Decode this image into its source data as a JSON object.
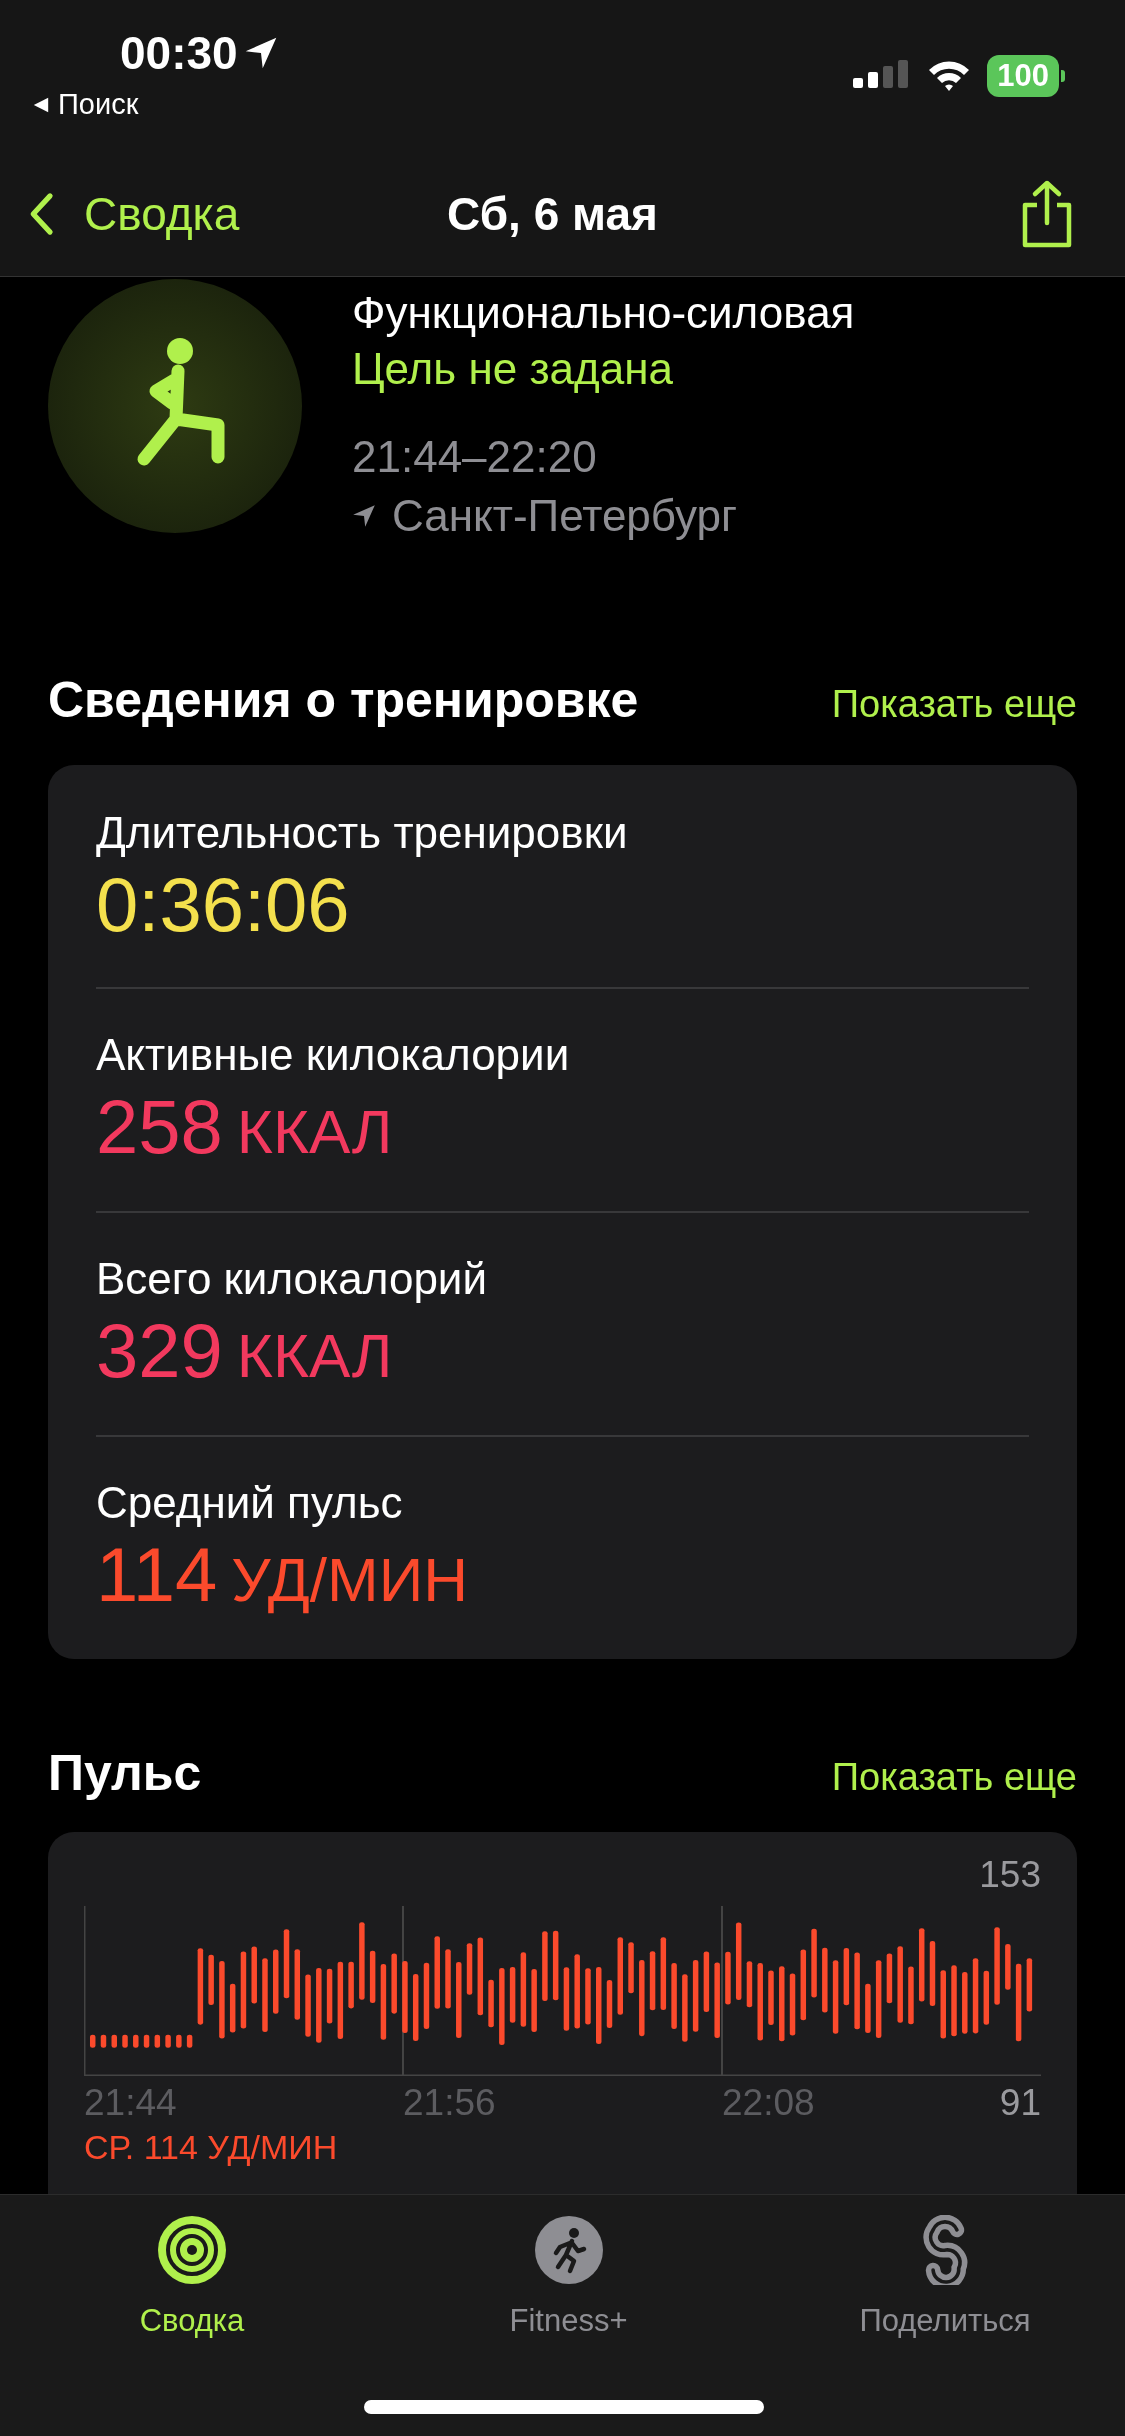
{
  "status_bar": {
    "time": "00:30",
    "back_label": "Поиск",
    "battery": "100"
  },
  "nav": {
    "back": "Сводка",
    "title": "Сб, 6 мая"
  },
  "workout": {
    "name": "Функционально-силовая",
    "goal": "Цель не задана",
    "time_range": "21:44–22:20",
    "location": "Санкт-Петербург"
  },
  "details": {
    "title": "Сведения о тренировке",
    "more": "Показать еще",
    "metrics": [
      {
        "label": "Длительность тренировки",
        "value": "0:36:06",
        "color": "#f4e04d"
      },
      {
        "label": "Активные килокалории",
        "value": "258",
        "unit": "ККАЛ",
        "color": "#f2395e"
      },
      {
        "label": "Всего килокалорий",
        "value": "329",
        "unit": "ККАЛ",
        "color": "#f2395e"
      },
      {
        "label": "Средний пульс",
        "value": "114",
        "unit": "УД/МИН",
        "color": "#fb4a2c"
      }
    ]
  },
  "heart_rate": {
    "title": "Пульс",
    "more": "Показать еще",
    "y_max": "153",
    "y_min": "91",
    "x_labels": [
      "21:44",
      "21:56",
      "22:08"
    ],
    "average": "СР. 114 УД/МИН"
  },
  "tab_bar": [
    {
      "label": "Сводка",
      "selected": true,
      "kind": "rings"
    },
    {
      "label": "Fitness+",
      "selected": false,
      "kind": "runner"
    },
    {
      "label": "Поделиться",
      "selected": false,
      "kind": "sharing"
    }
  ]
}
